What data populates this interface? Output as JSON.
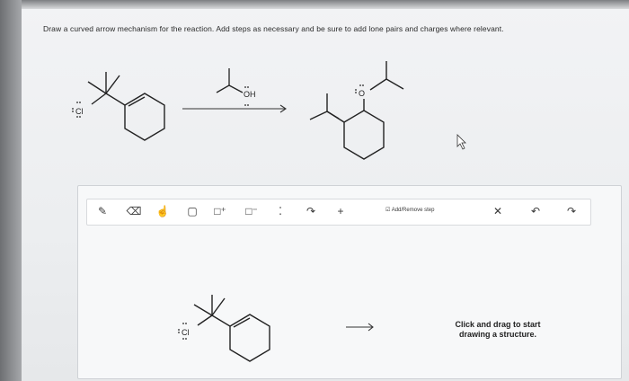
{
  "prompt": "Draw a curved arrow mechanism for the reaction. Add steps as necessary and be sure to add lone pairs and charges where relevant.",
  "reaction": {
    "reactant_atom": "Cl",
    "reagent_atom": "OH",
    "product_atom": "O"
  },
  "toolbar": {
    "tools": [
      {
        "name": "pencil-icon",
        "glyph": "✎"
      },
      {
        "name": "eraser-icon",
        "glyph": "⌫"
      },
      {
        "name": "hand-icon",
        "glyph": "☝"
      },
      {
        "name": "template-icon",
        "glyph": "▢"
      },
      {
        "name": "positive-charge-icon",
        "glyph": "□⁺"
      },
      {
        "name": "negative-charge-icon",
        "glyph": "□⁻"
      },
      {
        "name": "lone-pair-icon",
        "glyph": "⁚"
      },
      {
        "name": "curved-arrow-icon",
        "glyph": "↷"
      },
      {
        "name": "plus-icon",
        "glyph": "+"
      }
    ],
    "add_remove_label": "Add/Remove step",
    "close_glyph": "✕",
    "undo_glyph": "↶",
    "redo_glyph": "↷"
  },
  "canvas": {
    "atom": "Cl",
    "hint": "Click and drag to start drawing a structure."
  }
}
